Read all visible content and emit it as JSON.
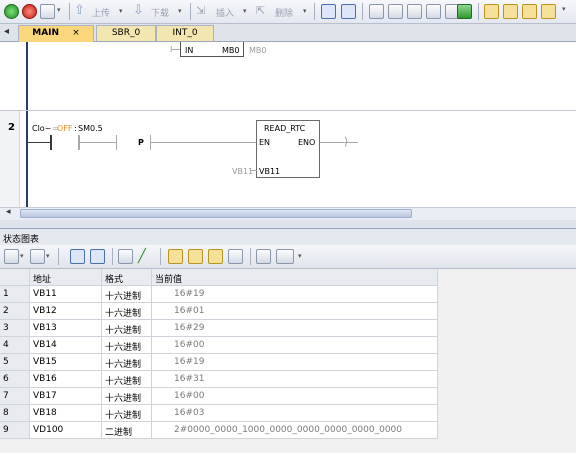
{
  "toolbar": {
    "upload_label": "上传",
    "download_label": "下载",
    "insert_label": "插入",
    "delete_label": "删除"
  },
  "tabs": [
    {
      "label": "MAIN"
    },
    {
      "label": "SBR_0"
    },
    {
      "label": "INT_0"
    }
  ],
  "tab_nav_left": "◂",
  "tab_close": "×",
  "network1": {
    "contact_label": "IN",
    "contact_addr": "MB0",
    "contact_echo": "MB0"
  },
  "network2": {
    "number": "2",
    "contact_prefix": "Clo~",
    "contact_state": "OFF",
    "contact_addr": "SM0.5",
    "p_label": "P",
    "block_title": "READ_RTC",
    "en": "EN",
    "eno": "ENO",
    "param_echo": "VB11",
    "param_addr": "VB11"
  },
  "status_chart": {
    "title": "状态图表",
    "headers": [
      "地址",
      "格式",
      "当前值"
    ],
    "rows": [
      {
        "n": "1",
        "addr": "VB11",
        "fmt": "十六进制",
        "val": "16#19"
      },
      {
        "n": "2",
        "addr": "VB12",
        "fmt": "十六进制",
        "val": "16#01"
      },
      {
        "n": "3",
        "addr": "VB13",
        "fmt": "十六进制",
        "val": "16#29"
      },
      {
        "n": "4",
        "addr": "VB14",
        "fmt": "十六进制",
        "val": "16#00"
      },
      {
        "n": "5",
        "addr": "VB15",
        "fmt": "十六进制",
        "val": "16#19"
      },
      {
        "n": "6",
        "addr": "VB16",
        "fmt": "十六进制",
        "val": "16#31"
      },
      {
        "n": "7",
        "addr": "VB17",
        "fmt": "十六进制",
        "val": "16#00"
      },
      {
        "n": "8",
        "addr": "VB18",
        "fmt": "十六进制",
        "val": "16#03"
      },
      {
        "n": "9",
        "addr": "VD100",
        "fmt": "二进制",
        "val": "2#0000_0000_1000_0000_0000_0000_0000_0000"
      }
    ]
  },
  "colors": {
    "rail": "#2a3a6a",
    "active_tab": "#f9d77a",
    "state_off": "#e58a2a"
  }
}
